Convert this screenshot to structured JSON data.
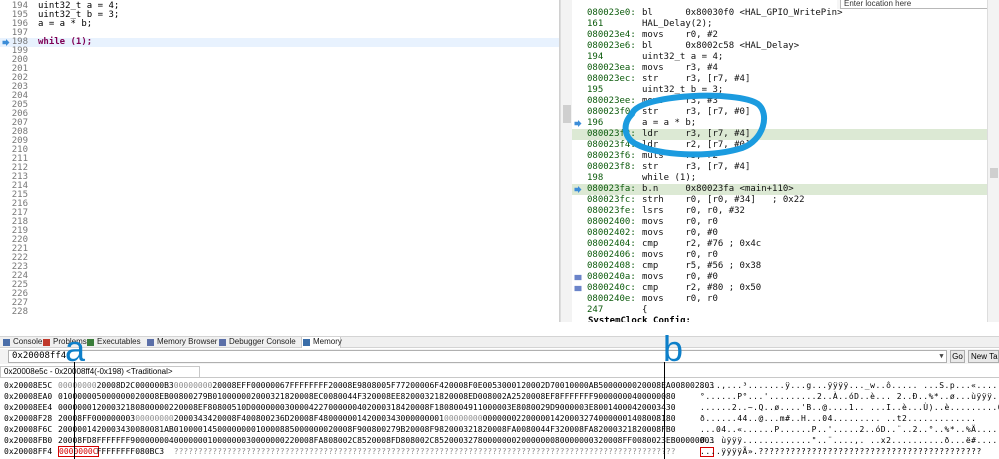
{
  "editor": {
    "lines": [
      {
        "num": "194",
        "code": "uint32_t a = 4;",
        "current": false,
        "marker": ""
      },
      {
        "num": "195",
        "code": "uint32_t b = 3;",
        "current": false,
        "marker": ""
      },
      {
        "num": "196",
        "code": "a = a * b;",
        "current": false,
        "marker": ""
      },
      {
        "num": "197",
        "code": "",
        "current": false,
        "marker": ""
      },
      {
        "num": "198",
        "code": "while (1);",
        "current": true,
        "marker": "arrow"
      },
      {
        "num": "199",
        "code": "",
        "current": false,
        "marker": ""
      },
      {
        "num": "200",
        "code": "",
        "current": false,
        "marker": ""
      },
      {
        "num": "201",
        "code": "",
        "current": false,
        "marker": ""
      },
      {
        "num": "202",
        "code": "",
        "current": false,
        "marker": ""
      },
      {
        "num": "203",
        "code": "",
        "current": false,
        "marker": ""
      },
      {
        "num": "204",
        "code": "",
        "current": false,
        "marker": ""
      },
      {
        "num": "205",
        "code": "",
        "current": false,
        "marker": ""
      },
      {
        "num": "206",
        "code": "",
        "current": false,
        "marker": ""
      },
      {
        "num": "207",
        "code": "",
        "current": false,
        "marker": ""
      },
      {
        "num": "208",
        "code": "",
        "current": false,
        "marker": ""
      },
      {
        "num": "209",
        "code": "",
        "current": false,
        "marker": ""
      },
      {
        "num": "210",
        "code": "",
        "current": false,
        "marker": ""
      },
      {
        "num": "211",
        "code": "",
        "current": false,
        "marker": ""
      },
      {
        "num": "212",
        "code": "",
        "current": false,
        "marker": ""
      },
      {
        "num": "213",
        "code": "",
        "current": false,
        "marker": ""
      },
      {
        "num": "214",
        "code": "",
        "current": false,
        "marker": ""
      },
      {
        "num": "215",
        "code": "",
        "current": false,
        "marker": ""
      },
      {
        "num": "216",
        "code": "",
        "current": false,
        "marker": ""
      },
      {
        "num": "217",
        "code": "",
        "current": false,
        "marker": ""
      },
      {
        "num": "218",
        "code": "",
        "current": false,
        "marker": ""
      },
      {
        "num": "219",
        "code": "",
        "current": false,
        "marker": ""
      },
      {
        "num": "220",
        "code": "",
        "current": false,
        "marker": ""
      },
      {
        "num": "221",
        "code": "",
        "current": false,
        "marker": ""
      },
      {
        "num": "222",
        "code": "",
        "current": false,
        "marker": ""
      },
      {
        "num": "223",
        "code": "",
        "current": false,
        "marker": ""
      },
      {
        "num": "224",
        "code": "",
        "current": false,
        "marker": ""
      },
      {
        "num": "225",
        "code": "",
        "current": false,
        "marker": ""
      },
      {
        "num": "226",
        "code": "",
        "current": false,
        "marker": ""
      },
      {
        "num": "227",
        "code": "",
        "current": false,
        "marker": ""
      },
      {
        "num": "228",
        "code": "",
        "current": false,
        "marker": ""
      }
    ]
  },
  "disassembly": {
    "location_placeholder": "Enter location here",
    "lines": [
      {
        "kind": "instr",
        "addr": "080023e0:",
        "text": "bl      0x80030f0 <HAL_GPIO_WritePin>",
        "current": false,
        "marker": ""
      },
      {
        "kind": "srcnum",
        "addr": "161",
        "text": "HAL_Delay(2);",
        "current": false,
        "marker": ""
      },
      {
        "kind": "instr",
        "addr": "080023e4:",
        "text": "movs    r0, #2",
        "current": false,
        "marker": ""
      },
      {
        "kind": "instr",
        "addr": "080023e6:",
        "text": "bl      0x8002c58 <HAL_Delay>",
        "current": false,
        "marker": ""
      },
      {
        "kind": "srcnum",
        "addr": "194",
        "text": "uint32_t a = 4;",
        "current": false,
        "marker": ""
      },
      {
        "kind": "instr",
        "addr": "080023ea:",
        "text": "movs    r3, #4",
        "current": false,
        "marker": ""
      },
      {
        "kind": "instr",
        "addr": "080023ec:",
        "text": "str     r3, [r7, #4]",
        "current": false,
        "marker": ""
      },
      {
        "kind": "srcnum",
        "addr": "195",
        "text": "uint32_t b = 3;",
        "current": false,
        "marker": ""
      },
      {
        "kind": "instr",
        "addr": "080023ee:",
        "text": "movs    r3, #3",
        "current": false,
        "marker": ""
      },
      {
        "kind": "instr",
        "addr": "080023f0:",
        "text": "str     r3, [r7, #0]",
        "current": false,
        "marker": ""
      },
      {
        "kind": "srcnum",
        "addr": "196",
        "text": "a = a * b;",
        "current": false,
        "marker": "bp"
      },
      {
        "kind": "instr",
        "addr": "080023f2:",
        "text": "ldr     r3, [r7, #4]",
        "current": true,
        "marker": ""
      },
      {
        "kind": "instr",
        "addr": "080023f4:",
        "text": "ldr     r2, [r7, #0]",
        "current": false,
        "marker": ""
      },
      {
        "kind": "instr",
        "addr": "080023f6:",
        "text": "muls    r3, r2",
        "current": false,
        "marker": ""
      },
      {
        "kind": "instr",
        "addr": "080023f8:",
        "text": "str     r3, [r7, #4]",
        "current": false,
        "marker": ""
      },
      {
        "kind": "srcnum",
        "addr": "198",
        "text": "while (1);",
        "current": false,
        "marker": ""
      },
      {
        "kind": "instr",
        "addr": "080023fa:",
        "text": "b.n     0x80023fa <main+110>",
        "current": true,
        "marker": "arrow"
      },
      {
        "kind": "instr",
        "addr": "080023fc:",
        "text": "strh    r0, [r0, #34]   ; 0x22",
        "current": false,
        "marker": ""
      },
      {
        "kind": "instr",
        "addr": "080023fe:",
        "text": "lsrs    r0, r0, #32",
        "current": false,
        "marker": ""
      },
      {
        "kind": "instr",
        "addr": "08002400:",
        "text": "movs    r0, r0",
        "current": false,
        "marker": ""
      },
      {
        "kind": "instr",
        "addr": "08002402:",
        "text": "movs    r0, #0",
        "current": false,
        "marker": ""
      },
      {
        "kind": "instr",
        "addr": "08002404:",
        "text": "cmp     r2, #76 ; 0x4c",
        "current": false,
        "marker": ""
      },
      {
        "kind": "instr",
        "addr": "08002406:",
        "text": "movs    r0, r0",
        "current": false,
        "marker": ""
      },
      {
        "kind": "instr",
        "addr": "08002408:",
        "text": "cmp     r5, #56 ; 0x38",
        "current": false,
        "marker": ""
      },
      {
        "kind": "instr",
        "addr": "0800240a:",
        "text": "movs    r0, #0",
        "current": false,
        "marker": "hit"
      },
      {
        "kind": "instr",
        "addr": "0800240c:",
        "text": "cmp     r2, #80 ; 0x50",
        "current": false,
        "marker": "hit"
      },
      {
        "kind": "instr",
        "addr": "0800240e:",
        "text": "movs    r0, r0",
        "current": false,
        "marker": ""
      },
      {
        "kind": "srcnum",
        "addr": "247",
        "text": "{",
        "current": false,
        "marker": ""
      },
      {
        "kind": "func",
        "addr": "",
        "text": "SystemClock_Config:",
        "current": false,
        "marker": ""
      },
      {
        "kind": "instr",
        "addr": "08002410:",
        "text": "push    {r4, r7, lr}",
        "current": false,
        "marker": ""
      },
      {
        "kind": "instr",
        "addr": "08002412:",
        "text": "sub     sp, #132        ; 0x84",
        "current": false,
        "marker": ""
      },
      {
        "kind": "instr",
        "addr": "08002414:",
        "text": "add     r7, sp, #0",
        "current": false,
        "marker": ""
      }
    ]
  },
  "views_tabs": [
    {
      "label": "Console",
      "icon": "console-icon",
      "active": false
    },
    {
      "label": "Problems",
      "icon": "problems-icon",
      "active": false
    },
    {
      "label": "Executables",
      "icon": "executables-icon",
      "active": false
    },
    {
      "label": "Memory Browser",
      "icon": "memory-browser-icon",
      "active": false
    },
    {
      "label": "Debugger Console",
      "icon": "debugger-console-icon",
      "active": false
    },
    {
      "label": "Memory",
      "icon": "memory-icon",
      "active": true
    }
  ],
  "memory": {
    "address_value": "0x20008ff4",
    "go_label": "Go",
    "new_tab_label": "New Tab",
    "rendering_tab_label": "0x20008e5c - 0x20008ff4(-0x198) <Traditional>",
    "rows": [
      {
        "addr": "0x20008E5C",
        "words": [
          "00000000",
          "20008D2C",
          "000000B3",
          "00000000",
          "20008EFF",
          "00000067",
          "FFFFFFFF",
          "20008E98",
          "08005F77",
          "200006F4",
          "20008F0E",
          "00530001",
          "20002D70",
          "010000AB",
          "50000000",
          "20008EA0",
          "08002803"
        ],
        "ascii": "....,...³.......ÿ...g...ÿÿÿÿ..._w..ô..... ...S.p...«......P...("
      },
      {
        "addr": "0x20008EA0",
        "words": [
          "01000000",
          "50000000",
          "20008EB0",
          "0800279B",
          "01000000",
          "20003218",
          "20008EC0",
          "080044F3",
          "20008EE8",
          "20003218",
          "20008ED0",
          "08002A25",
          "20008EF8",
          "FFFFFFF9",
          "00000004",
          "00000080"
        ],
        "ascii": "°......P°...'.........2..À..óD..è... 2..Ð..%*..ø...ùÿÿÿ........"
      },
      {
        "addr": "0x20008EE4",
        "words": [
          "00000001",
          "20003218",
          "08000002",
          "20008EF8",
          "0800510D",
          "00000003",
          "00004227",
          "00000040",
          "20003184",
          "20008F18",
          "08004911",
          "000003E8",
          "080029D9",
          "000003E8",
          "00140004",
          "20003430"
        ],
        "ascii": "......2..~.Q..ø....'B..@....1.. ...I..è...Ù)..è.........04.."
      },
      {
        "addr": "0x20008F28",
        "words": [
          "20008FF0",
          "00000003",
          "00000000",
          "20003434",
          "20008F40",
          "0800236D",
          "20008F48",
          "00000014",
          "20003430",
          "00000001",
          "00000000",
          "00000002",
          "20000014",
          "20003274",
          "00000014",
          "08008180"
        ],
        "ascii": "ð......44..@...m#..H...04......... ..t2............."
      },
      {
        "addr": "0x20008F6C",
        "words": [
          "20000014",
          "20003430",
          "080081AB",
          "01000014",
          "50000000",
          "01000088",
          "50000000",
          "20008F90",
          "0800279B",
          "20008F98",
          "20003218",
          "20008FA0",
          "080044F3",
          "20008FA8",
          "20003218",
          "20008FB0"
        ],
        "ascii": "...04..«......P......P..'.....2..óD..¨..2..°..%*..%Ä...."
      },
      {
        "addr": "0x20008FB0",
        "words": [
          "20008FD8",
          "FFFFFFF9",
          "00000004",
          "00000001",
          "00000003",
          "00000002",
          "20008FA8",
          "08002C85",
          "20008FD8",
          "08002C85",
          "20003278",
          "00000002",
          "00000008",
          "00000003",
          "20008FF0",
          "080023EB",
          "00000003"
        ],
        "ascii": "Ø.. ùÿÿÿ.............\"..¨....,. ..x2..........ð...ë#...."
      },
      {
        "addr": "0x20008FF4",
        "words": [
          "0000000C",
          "FFFFFFFF",
          "080BC3",
          "????????",
          "????????",
          "????????",
          "????????",
          "????????",
          "????????",
          "????????",
          "????????",
          "????????",
          "????????",
          "????????",
          "????????",
          "????????"
        ],
        "ascii": "....ÿÿÿÿÃ».??????????????????????????????????????????"
      }
    ]
  },
  "annotations": {
    "a_label": "a",
    "b_label": "b"
  }
}
